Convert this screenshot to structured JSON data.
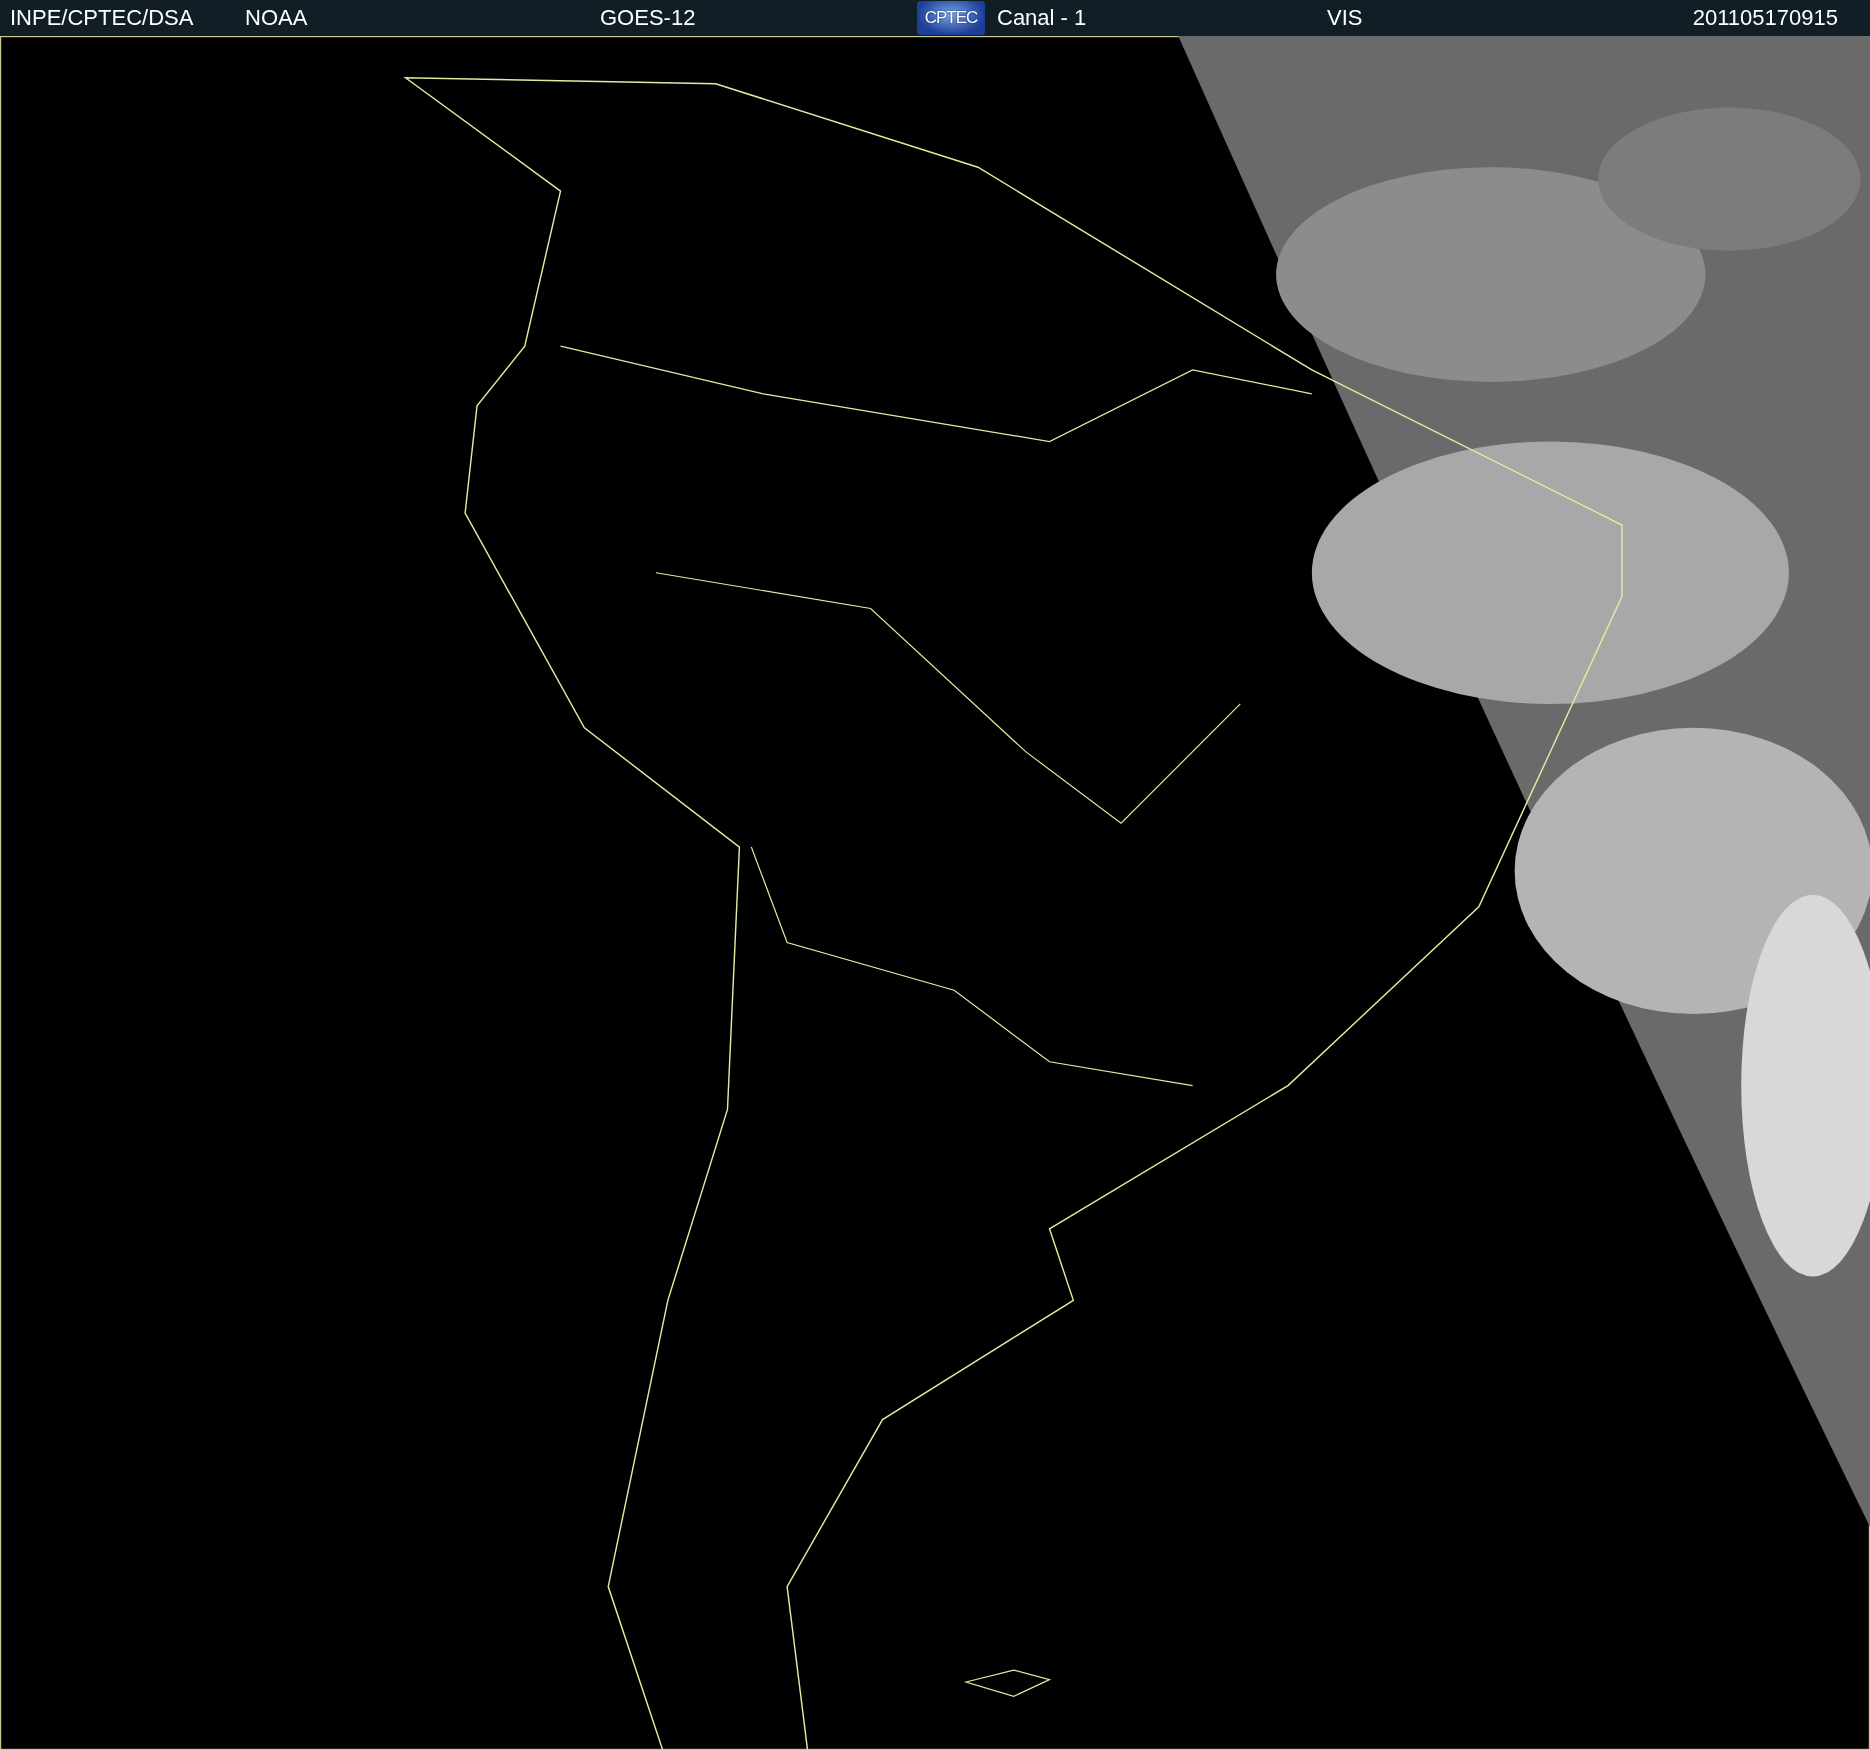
{
  "header": {
    "source": "INPE/CPTEC/DSA",
    "agency": "NOAA",
    "satellite": "GOES-12",
    "logo": "CPTEC",
    "channel": "Canal - 1",
    "band": "VIS",
    "timestamp": "201105170915"
  }
}
